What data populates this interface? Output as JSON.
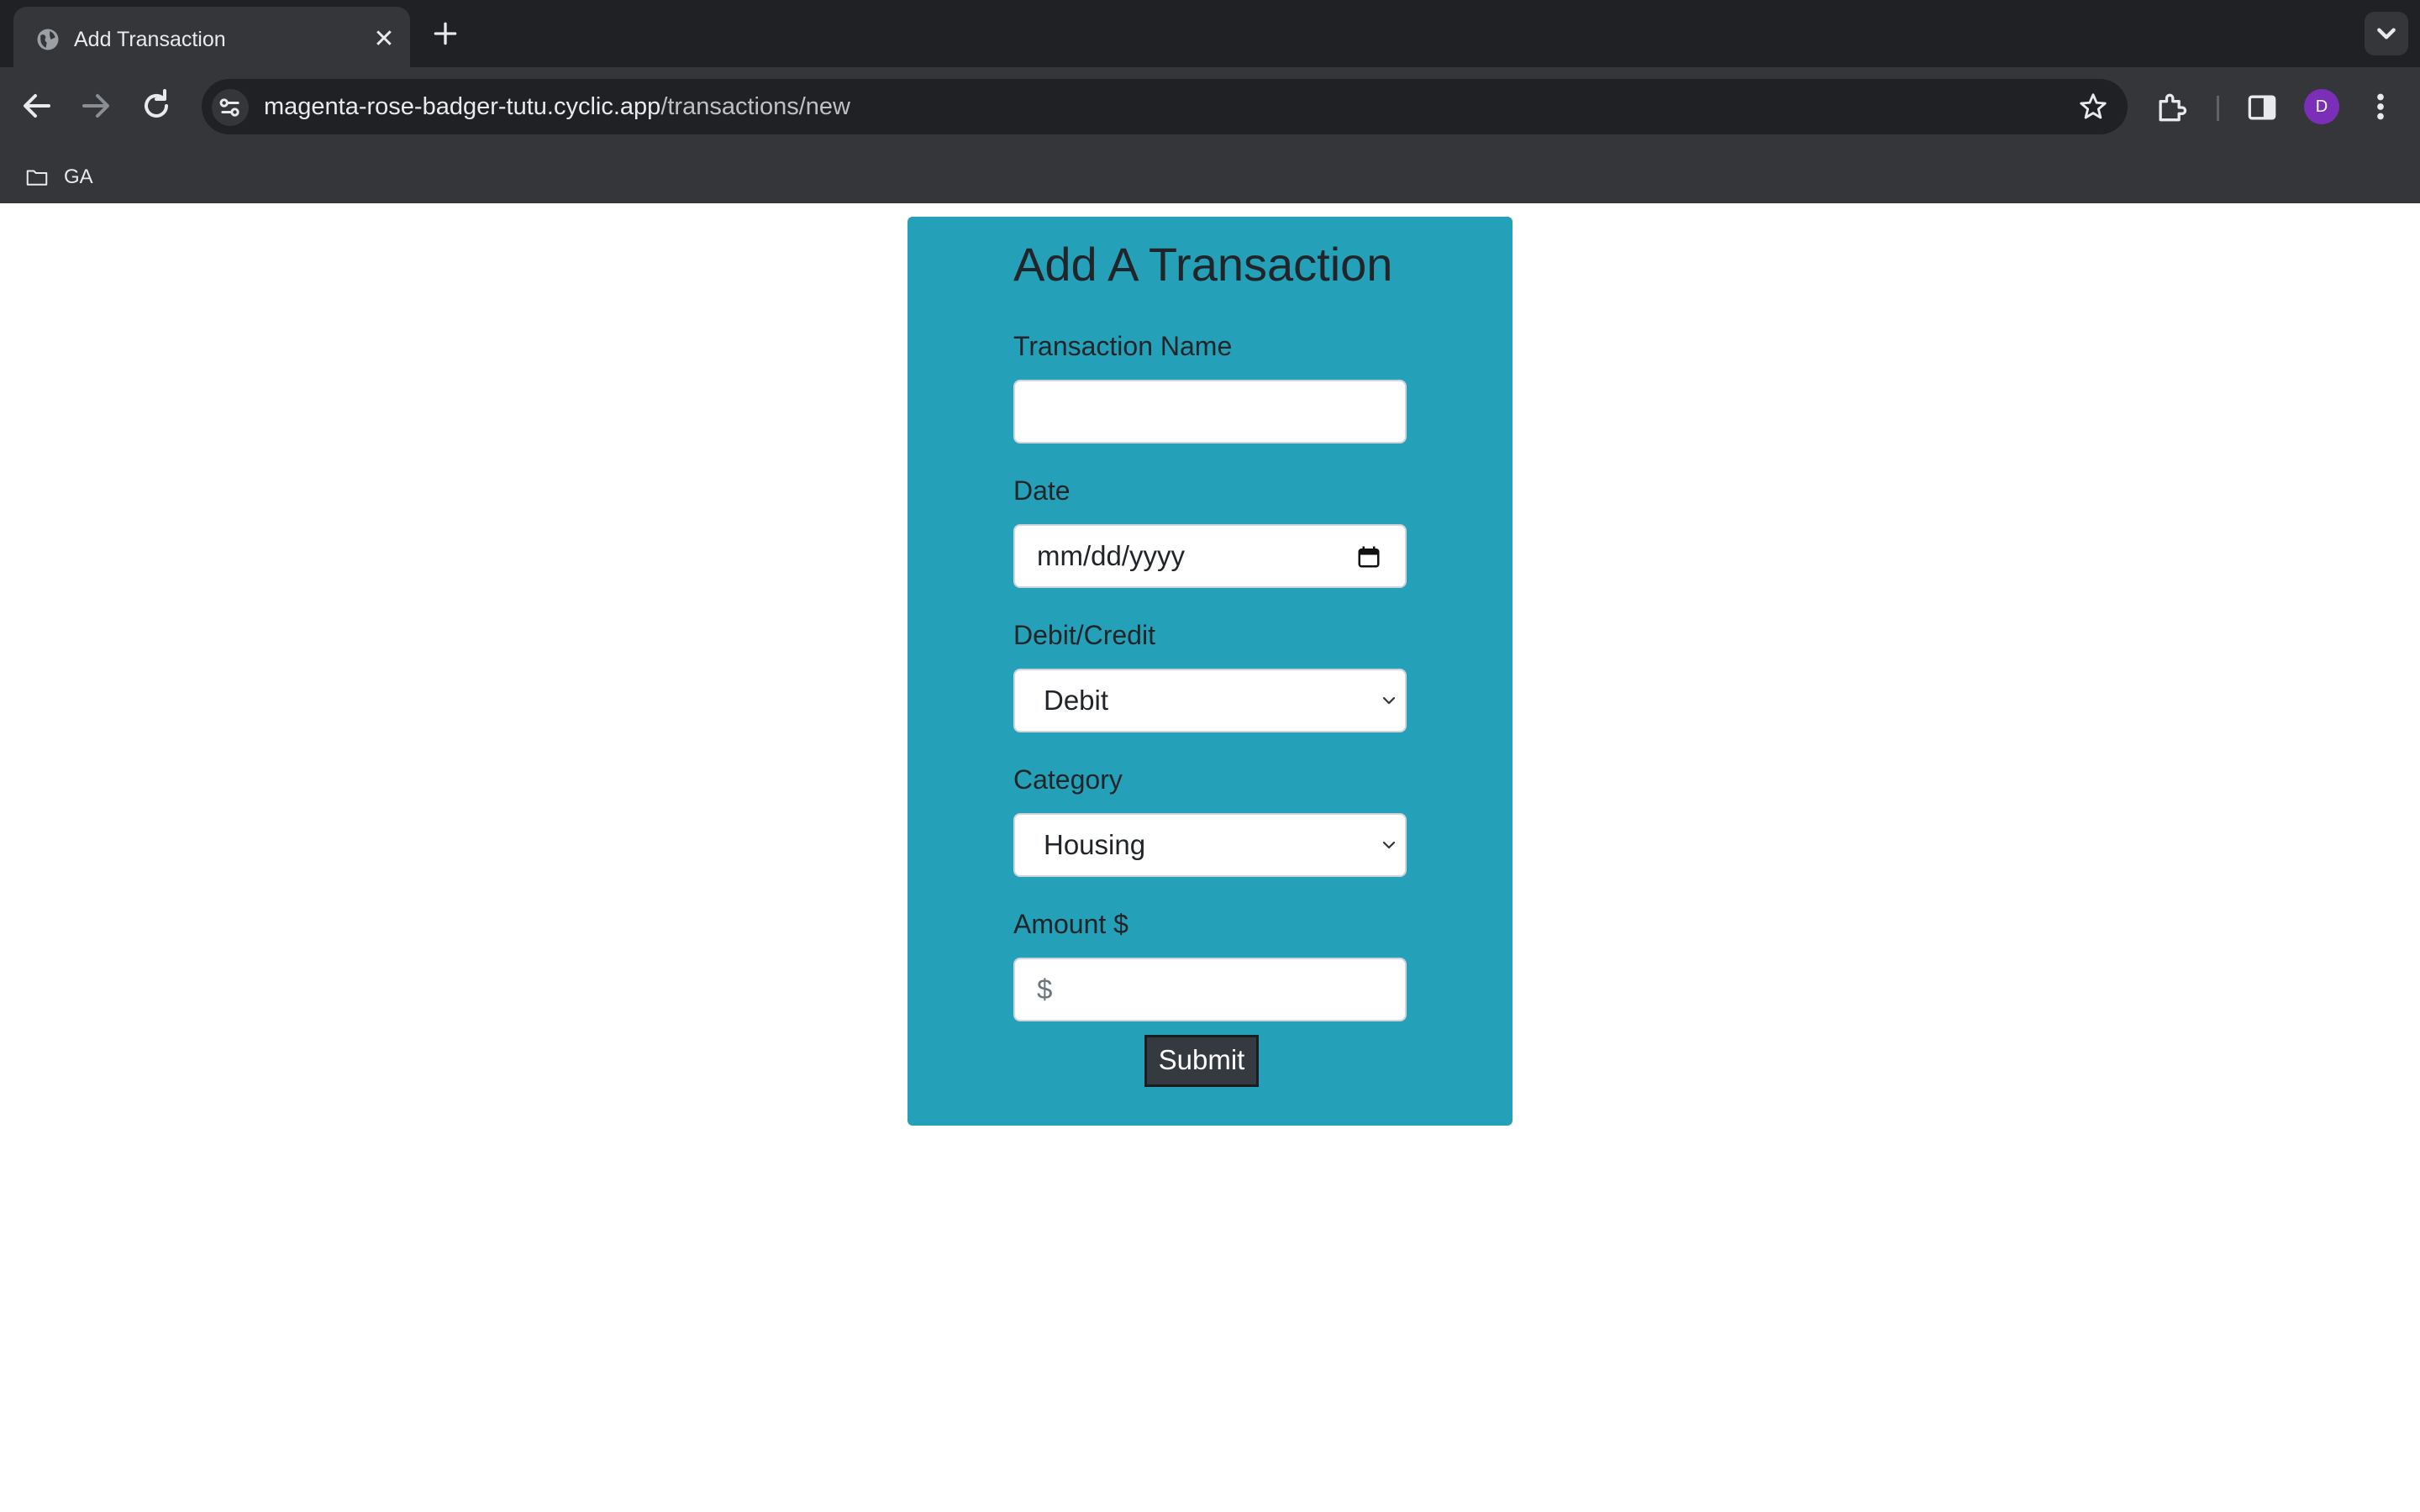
{
  "browser": {
    "tab_title": "Add Transaction",
    "url_host": "magenta-rose-badger-tutu.cyclic.app",
    "url_path": "/transactions/new",
    "profile_initial": "D",
    "bookmarks": [
      {
        "label": "GA"
      }
    ]
  },
  "form": {
    "title": "Add A Transaction",
    "name_label": "Transaction Name",
    "name_value": "",
    "date_label": "Date",
    "date_placeholder": "mm/dd/yyyy",
    "type_label": "Debit/Credit",
    "type_selected": "Debit",
    "category_label": "Category",
    "category_selected": "Housing",
    "amount_label": "Amount $",
    "amount_placeholder": "$",
    "submit_label": "Submit"
  },
  "colors": {
    "card_background": "#24a1b8",
    "submit_background": "#343a40",
    "avatar": "#7b2fb8"
  }
}
